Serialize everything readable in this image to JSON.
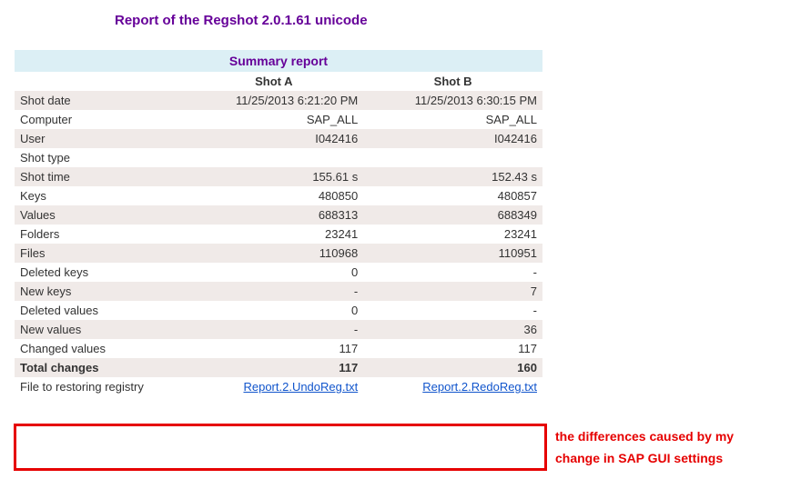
{
  "title": "Report of the Regshot 2.0.1.61 unicode",
  "summary_label": "Summary report",
  "columns": {
    "a": "Shot A",
    "b": "Shot B"
  },
  "rows": [
    {
      "label": "Shot date",
      "a": "11/25/2013 6:21:20 PM",
      "b": "11/25/2013 6:30:15 PM"
    },
    {
      "label": "Computer",
      "a": "SAP_ALL",
      "b": "SAP_ALL"
    },
    {
      "label": "User",
      "a": "I042416",
      "b": "I042416"
    },
    {
      "label": "Shot type",
      "a": "",
      "b": ""
    },
    {
      "label": "Shot time",
      "a": "155.61 s",
      "b": "152.43 s"
    },
    {
      "label": "Keys",
      "a": "480850",
      "b": "480857"
    },
    {
      "label": "Values",
      "a": "688313",
      "b": "688349"
    },
    {
      "label": "Folders",
      "a": "23241",
      "b": "23241"
    },
    {
      "label": "Files",
      "a": "110968",
      "b": "110951"
    },
    {
      "label": "Deleted keys",
      "a": "0",
      "b": "-"
    },
    {
      "label": "New keys",
      "a": "-",
      "b": "7"
    },
    {
      "label": "Deleted values",
      "a": "0",
      "b": "-"
    },
    {
      "label": "New values",
      "a": "-",
      "b": "36"
    },
    {
      "label": "Changed values",
      "a": "117",
      "b": "117"
    }
  ],
  "total_row": {
    "label": "Total changes",
    "a": "117",
    "b": "160"
  },
  "file_row": {
    "label": "File to restoring registry",
    "a": "Report.2.UndoReg.txt",
    "b": "Report.2.RedoReg.txt"
  },
  "annotation": {
    "line1": "the differences caused by my",
    "line2": "change in SAP GUI settings"
  },
  "chart_data": {
    "type": "table",
    "title": "Summary report",
    "columns": [
      "",
      "Shot A",
      "Shot B"
    ],
    "rows": [
      [
        "Shot date",
        "11/25/2013 6:21:20 PM",
        "11/25/2013 6:30:15 PM"
      ],
      [
        "Computer",
        "SAP_ALL",
        "SAP_ALL"
      ],
      [
        "User",
        "I042416",
        "I042416"
      ],
      [
        "Shot type",
        "",
        ""
      ],
      [
        "Shot time",
        "155.61 s",
        "152.43 s"
      ],
      [
        "Keys",
        480850,
        480857
      ],
      [
        "Values",
        688313,
        688349
      ],
      [
        "Folders",
        23241,
        23241
      ],
      [
        "Files",
        110968,
        110951
      ],
      [
        "Deleted keys",
        0,
        "-"
      ],
      [
        "New keys",
        "-",
        7
      ],
      [
        "Deleted values",
        0,
        "-"
      ],
      [
        "New values",
        "-",
        36
      ],
      [
        "Changed values",
        117,
        117
      ],
      [
        "Total changes",
        117,
        160
      ],
      [
        "File to restoring registry",
        "Report.2.UndoReg.txt",
        "Report.2.RedoReg.txt"
      ]
    ]
  }
}
